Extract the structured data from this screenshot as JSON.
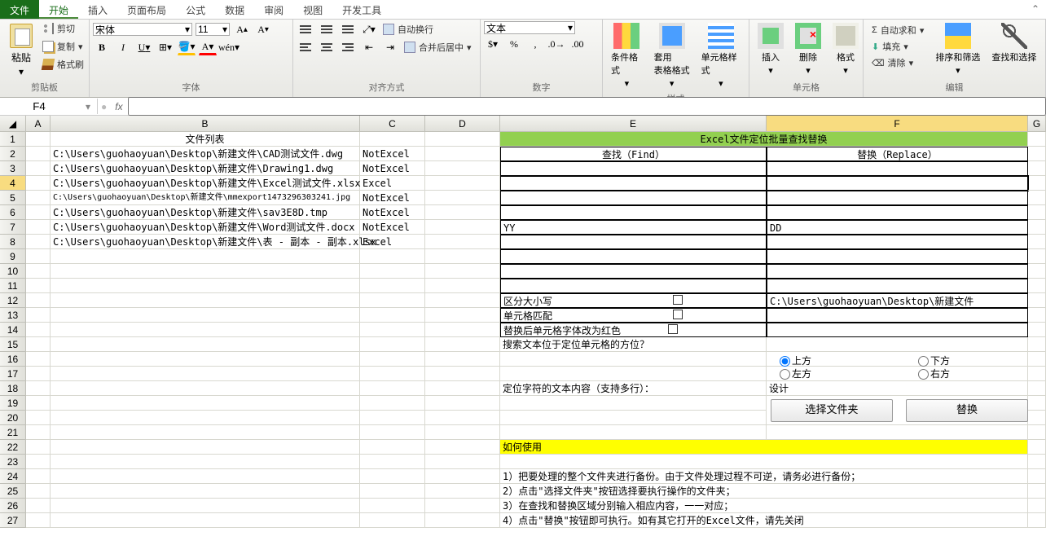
{
  "tabs": [
    "文件",
    "开始",
    "插入",
    "页面布局",
    "公式",
    "数据",
    "审阅",
    "视图",
    "开发工具"
  ],
  "ribbon": {
    "clipboard": {
      "paste": "粘贴",
      "cut": "剪切",
      "copy": "复制",
      "brush": "格式刷",
      "label": "剪贴板"
    },
    "font": {
      "name": "宋体",
      "size": "11",
      "label": "字体"
    },
    "align": {
      "wrap": "自动换行",
      "merge": "合并后居中",
      "label": "对齐方式"
    },
    "number": {
      "format": "文本",
      "label": "数字"
    },
    "styles": {
      "cond": "条件格式",
      "table": "套用\n表格格式",
      "cell": "单元格样式",
      "label": "样式"
    },
    "cells": {
      "insert": "插入",
      "delete": "删除",
      "format": "格式",
      "label": "单元格"
    },
    "editing": {
      "sum": "自动求和",
      "fill": "填充",
      "clear": "清除",
      "sort": "排序和筛选",
      "find": "查找和选择",
      "label": "编辑"
    }
  },
  "namebox": "F4",
  "cols": [
    "A",
    "B",
    "C",
    "D",
    "E",
    "F",
    "G"
  ],
  "sheet": {
    "B1": "文件列表",
    "B2": "C:\\Users\\guohaoyuan\\Desktop\\新建文件\\CAD测试文件.dwg",
    "C2": "NotExcel",
    "B3": "C:\\Users\\guohaoyuan\\Desktop\\新建文件\\Drawing1.dwg",
    "C3": "NotExcel",
    "B4": "C:\\Users\\guohaoyuan\\Desktop\\新建文件\\Excel测试文件.xlsx",
    "C4": "Excel",
    "B5": "C:\\Users\\guohaoyuan\\Desktop\\新建文件\\mmexport1473296303241.jpg",
    "C5": "NotExcel",
    "B6": "C:\\Users\\guohaoyuan\\Desktop\\新建文件\\sav3E8D.tmp",
    "C6": "NotExcel",
    "B7": "C:\\Users\\guohaoyuan\\Desktop\\新建文件\\Word测试文件.docx",
    "C7": "NotExcel",
    "B8": "C:\\Users\\guohaoyuan\\Desktop\\新建文件\\表 - 副本 - 副本.xlsx",
    "C8": "Excel",
    "E1": "Excel文件定位批量查找替换",
    "E2": "查找（Find）",
    "F2": "替换（Replace）",
    "E7": "YY",
    "F7": "DD",
    "E12": "区分大小写",
    "F12": "C:\\Users\\guohaoyuan\\Desktop\\新建文件",
    "E13": "单元格匹配",
    "E14": "替换后单元格字体改为红色",
    "E15": "搜索文本位于定位单元格的方位？",
    "E18": "定位字符的文本内容（支持多行）：",
    "F18": "设计",
    "E22": "如何使用",
    "E24": "1）把要处理的整个文件夹进行备份。由于文件处理过程不可逆，请务必进行备份；",
    "E25": "2）点击\"选择文件夹\"按钮选择要执行操作的文件夹；",
    "E26": "3）在查找和替换区域分别输入相应内容，一一对应；",
    "E27": "4）点击\"替换\"按钮即可执行。如有其它打开的Excel文件，请先关闭"
  },
  "radios": {
    "up": "上方",
    "down": "下方",
    "left": "左方",
    "right": "右方"
  },
  "buttons": {
    "choose": "选择文件夹",
    "replace": "替换"
  }
}
